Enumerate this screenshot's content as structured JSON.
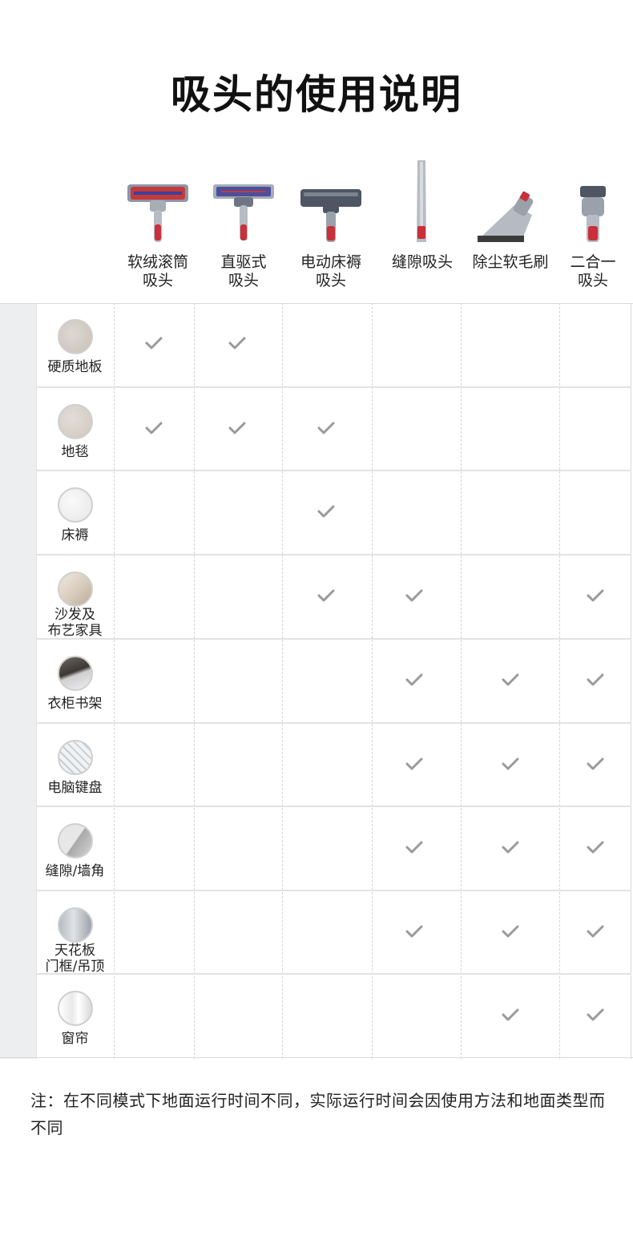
{
  "page_title": "吸头的使用说明",
  "tools": [
    {
      "label": "软绒滚筒\n吸头",
      "icon": "fluffy-roller-head-icon"
    },
    {
      "label": "直驱式\n吸头",
      "icon": "direct-drive-head-icon"
    },
    {
      "label": "电动床褥\n吸头",
      "icon": "mini-motorized-head-icon"
    },
    {
      "label": "缝隙吸头",
      "icon": "crevice-tool-icon"
    },
    {
      "label": "除尘软毛刷",
      "icon": "soft-dusting-brush-icon"
    },
    {
      "label": "二合一\n吸头",
      "icon": "combination-tool-icon"
    }
  ],
  "surfaces": [
    {
      "name": "硬质地板",
      "icon": "hard-floor-icon",
      "checks": [
        true,
        true,
        false,
        false,
        false,
        false
      ]
    },
    {
      "name": "地毯",
      "icon": "carpet-icon",
      "checks": [
        true,
        true,
        true,
        false,
        false,
        false
      ]
    },
    {
      "name": "床褥",
      "icon": "mattress-icon",
      "checks": [
        false,
        false,
        true,
        false,
        false,
        false
      ]
    },
    {
      "name": "沙发及\n布艺家具",
      "icon": "sofa-icon",
      "checks": [
        false,
        false,
        true,
        true,
        false,
        true
      ]
    },
    {
      "name": "衣柜书架",
      "icon": "wardrobe-icon",
      "checks": [
        false,
        false,
        false,
        true,
        true,
        true
      ]
    },
    {
      "name": "电脑键盘",
      "icon": "keyboard-icon",
      "checks": [
        false,
        false,
        false,
        true,
        true,
        true
      ]
    },
    {
      "name": "缝隙/墙角",
      "icon": "wall-corner-icon",
      "checks": [
        false,
        false,
        false,
        true,
        true,
        true
      ]
    },
    {
      "name": "天花板\n门框/吊顶",
      "icon": "ceiling-icon",
      "checks": [
        false,
        false,
        false,
        true,
        true,
        true
      ]
    },
    {
      "name": "窗帘",
      "icon": "curtain-icon",
      "checks": [
        false,
        false,
        false,
        false,
        true,
        true
      ]
    }
  ],
  "note": "注：在不同模式下地面运行时间不同，实际运行时间会因使用方法和地面类型而不同",
  "colors": {
    "check": "#9a9a9a",
    "grid_line": "#e2e2e2",
    "sidebar": "#eceeef"
  }
}
